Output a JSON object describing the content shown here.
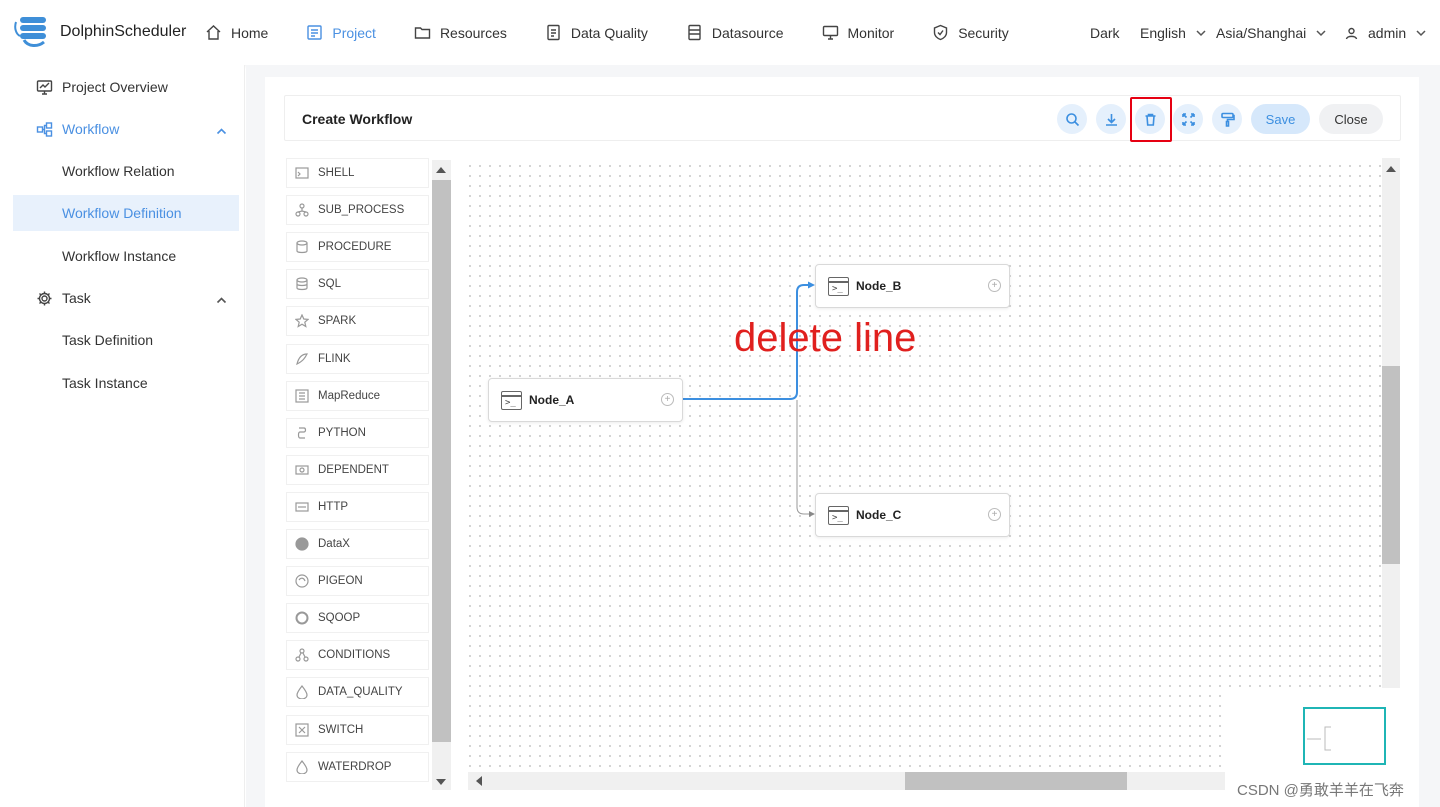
{
  "app": {
    "name": "DolphinScheduler"
  },
  "nav": {
    "items": [
      {
        "label": "Home",
        "icon": "home-icon",
        "active": false
      },
      {
        "label": "Project",
        "icon": "project-icon",
        "active": true
      },
      {
        "label": "Resources",
        "icon": "folder-icon",
        "active": false
      },
      {
        "label": "Data Quality",
        "icon": "data-quality-icon",
        "active": false
      },
      {
        "label": "Datasource",
        "icon": "datasource-icon",
        "active": false
      },
      {
        "label": "Monitor",
        "icon": "monitor-icon",
        "active": false
      },
      {
        "label": "Security",
        "icon": "shield-icon",
        "active": false
      }
    ]
  },
  "header_right": {
    "theme": "Dark",
    "language": "English",
    "timezone": "Asia/Shanghai",
    "user": "admin"
  },
  "sidebar": {
    "items": [
      {
        "label": "Project Overview",
        "icon": "overview-icon"
      },
      {
        "label": "Workflow",
        "icon": "workflow-icon",
        "expanded": true
      },
      {
        "label": "Workflow Relation"
      },
      {
        "label": "Workflow Definition",
        "selected": true
      },
      {
        "label": "Workflow Instance"
      },
      {
        "label": "Task",
        "icon": "gear-icon",
        "expanded": true
      },
      {
        "label": "Task Definition"
      },
      {
        "label": "Task Instance"
      }
    ]
  },
  "toolbar": {
    "title": "Create Workflow",
    "buttons": [
      {
        "name": "search",
        "icon": "search-icon"
      },
      {
        "name": "download",
        "icon": "download-icon"
      },
      {
        "name": "delete",
        "icon": "trash-icon",
        "highlighted": true
      },
      {
        "name": "fullscreen",
        "icon": "fullscreen-icon"
      },
      {
        "name": "format",
        "icon": "format-painter-icon"
      }
    ],
    "save_label": "Save",
    "close_label": "Close"
  },
  "palette": {
    "items": [
      "SHELL",
      "SUB_PROCESS",
      "PROCEDURE",
      "SQL",
      "SPARK",
      "FLINK",
      "MapReduce",
      "PYTHON",
      "DEPENDENT",
      "HTTP",
      "DataX",
      "PIGEON",
      "SQOOP",
      "CONDITIONS",
      "DATA_QUALITY",
      "SWITCH",
      "WATERDROP"
    ]
  },
  "canvas": {
    "nodes": [
      {
        "label": "Node_A",
        "prompt": ">_"
      },
      {
        "label": "Node_B",
        "prompt": ">_"
      },
      {
        "label": "Node_C",
        "prompt": ">_"
      }
    ],
    "edges": [
      {
        "from": "Node_A",
        "to": "Node_B",
        "selected": true
      },
      {
        "from": "Node_A",
        "to": "Node_C",
        "selected": false
      }
    ],
    "annotation": "delete line"
  },
  "colors": {
    "accent": "#4a90e2",
    "highlight": "#e60012",
    "annotation": "#e0201e",
    "minimap": "#1fb5b5"
  },
  "watermark": "CSDN @勇敢羊羊在飞奔"
}
